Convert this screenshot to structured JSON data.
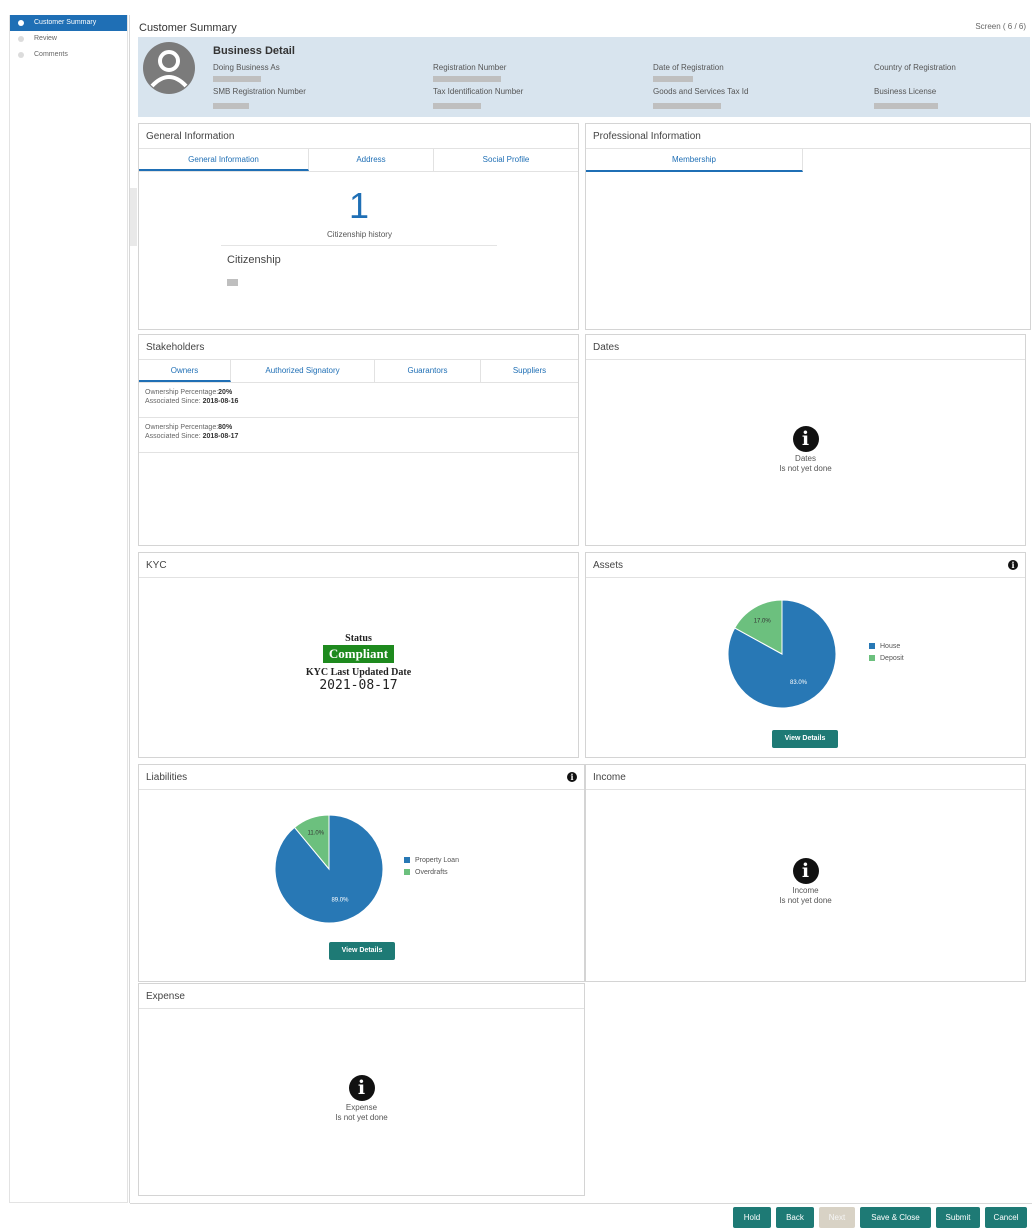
{
  "sidebar": {
    "items": [
      {
        "label": "Customer Summary"
      },
      {
        "label": "Review"
      },
      {
        "label": "Comments"
      }
    ]
  },
  "header": {
    "title": "Customer Summary",
    "screen": "Screen ( 6 / 6)"
  },
  "business_detail": {
    "title": "Business Detail",
    "fields": [
      {
        "label": "Doing Business As"
      },
      {
        "label": "Registration Number"
      },
      {
        "label": "Date of Registration"
      },
      {
        "label": "Country of Registration"
      },
      {
        "label": "SMB Registration Number"
      },
      {
        "label": "Tax Identification Number"
      },
      {
        "label": "Goods and Services Tax Id"
      },
      {
        "label": "Business License"
      }
    ]
  },
  "general_information": {
    "title": "General Information",
    "tabs": [
      "General Information",
      "Address",
      "Social Profile"
    ],
    "count": "1",
    "count_label": "Citizenship history",
    "section_label": "Citizenship"
  },
  "professional_information": {
    "title": "Professional Information",
    "tabs": [
      "Membership"
    ]
  },
  "stakeholders": {
    "title": "Stakeholders",
    "tabs": [
      "Owners",
      "Authorized Signatory",
      "Guarantors",
      "Suppliers"
    ],
    "owners": [
      {
        "pct_label": "Ownership Percentage:",
        "pct": "20%",
        "since_label": "Associated Since: ",
        "since": "2018-08-16"
      },
      {
        "pct_label": "Ownership Percentage:",
        "pct": "80%",
        "since_label": "Associated Since: ",
        "since": "2018-08-17"
      }
    ]
  },
  "dates": {
    "title": "Dates",
    "empty_title": "Dates",
    "empty_text": "Is not yet done"
  },
  "kyc": {
    "title": "KYC",
    "status_label": "Status",
    "status": "Compliant",
    "status_color": "#1e8a1e",
    "updated_label": "KYC Last Updated Date",
    "updated_date": "2021-08-17"
  },
  "assets": {
    "title": "Assets",
    "button": "View Details"
  },
  "liabilities": {
    "title": "Liabilities",
    "button": "View Details"
  },
  "income": {
    "title": "Income",
    "empty_title": "Income",
    "empty_text": "Is not yet done"
  },
  "expense": {
    "title": "Expense",
    "empty_title": "Expense",
    "empty_text": "Is not yet done"
  },
  "chart_data": [
    {
      "type": "pie",
      "chart": "assets",
      "categories": [
        "House",
        "Deposit"
      ],
      "values": [
        83.0,
        17.0
      ],
      "labels": [
        "83.0%",
        "17.0%"
      ],
      "colors": [
        "#2878b5",
        "#6cc07e"
      ],
      "legend": "right"
    },
    {
      "type": "pie",
      "chart": "liabilities",
      "categories": [
        "Property Loan",
        "Overdrafts"
      ],
      "values": [
        89.0,
        11.0
      ],
      "labels": [
        "89.0%",
        "11.0%"
      ],
      "colors": [
        "#2878b5",
        "#6cc07e"
      ],
      "legend": "right"
    }
  ],
  "footer": {
    "buttons": [
      "Hold",
      "Back",
      "Next",
      "Save & Close",
      "Submit",
      "Cancel"
    ],
    "accent": "#1e7a75"
  }
}
